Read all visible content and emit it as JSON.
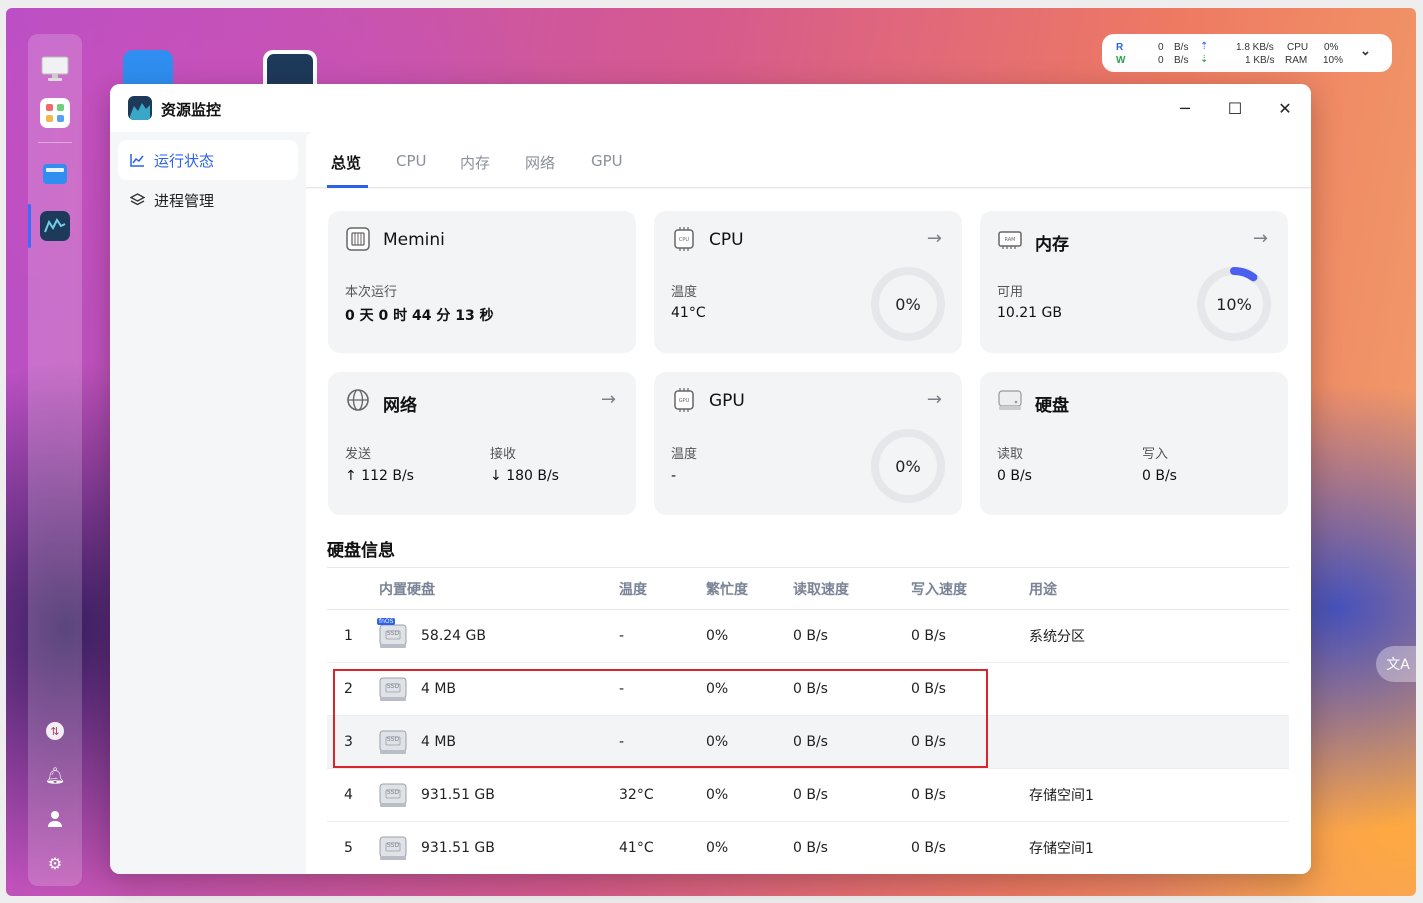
{
  "status_widget": {
    "r_label": "R",
    "w_label": "W",
    "r_value": "0",
    "r_unit": "B/s",
    "w_value": "0",
    "w_unit": "B/s",
    "net_up": "1.8 KB/s",
    "net_down": "1 KB/s",
    "cpu_label": "CPU",
    "cpu_value": "0%",
    "ram_label": "RAM",
    "ram_value": "10%"
  },
  "window": {
    "title": "资源监控"
  },
  "sidebar": {
    "items": [
      {
        "label": "运行状态",
        "icon": "line-chart-icon"
      },
      {
        "label": "进程管理",
        "icon": "layers-icon"
      }
    ]
  },
  "tabs": [
    "总览",
    "CPU",
    "内存",
    "网络",
    "GPU"
  ],
  "cards": {
    "system": {
      "title": "Memini",
      "uptime_label": "本次运行",
      "uptime": [
        {
          "n": "0",
          "u": "天"
        },
        {
          "n": "0",
          "u": "时"
        },
        {
          "n": "44",
          "u": "分"
        },
        {
          "n": "13",
          "u": "秒"
        }
      ]
    },
    "cpu": {
      "title": "CPU",
      "temp_label": "温度",
      "temp": "41°C",
      "usage": "0%",
      "usage_value": 0
    },
    "memory": {
      "title": "内存",
      "avail_label": "可用",
      "avail": "10.21 GB",
      "usage": "10%",
      "usage_value": 10
    },
    "network": {
      "title": "网络",
      "send_label": "发送",
      "send": "112 B/s",
      "recv_label": "接收",
      "recv": "180 B/s"
    },
    "gpu": {
      "title": "GPU",
      "temp_label": "温度",
      "temp": "-",
      "usage": "0%",
      "usage_value": 0
    },
    "disk": {
      "title": "硬盘",
      "read_label": "读取",
      "read": "0 B/s",
      "write_label": "写入",
      "write": "0 B/s"
    }
  },
  "disk_section": {
    "title": "硬盘信息",
    "columns": [
      "内置硬盘",
      "温度",
      "繁忙度",
      "读取速度",
      "写入速度",
      "用途"
    ],
    "rows": [
      {
        "idx": "1",
        "badge": "fnOS",
        "size": "58.24 GB",
        "temp": "-",
        "busy": "0%",
        "read": "0 B/s",
        "write": "0 B/s",
        "use": "系统分区"
      },
      {
        "idx": "2",
        "badge": "",
        "size": "4 MB",
        "temp": "-",
        "busy": "0%",
        "read": "0 B/s",
        "write": "0 B/s",
        "use": ""
      },
      {
        "idx": "3",
        "badge": "",
        "size": "4 MB",
        "temp": "-",
        "busy": "0%",
        "read": "0 B/s",
        "write": "0 B/s",
        "use": ""
      },
      {
        "idx": "4",
        "badge": "",
        "size": "931.51 GB",
        "temp": "32°C",
        "busy": "0%",
        "read": "0 B/s",
        "write": "0 B/s",
        "use": "存储空间1"
      },
      {
        "idx": "5",
        "badge": "",
        "size": "931.51 GB",
        "temp": "41°C",
        "busy": "0%",
        "read": "0 B/s",
        "write": "0 B/s",
        "use": "存储空间1"
      }
    ],
    "ssd_label": "SSD"
  },
  "colors": {
    "accent": "#2c62e8",
    "highlight": "#d8262b",
    "ring_fill": "#4a5ff0"
  }
}
